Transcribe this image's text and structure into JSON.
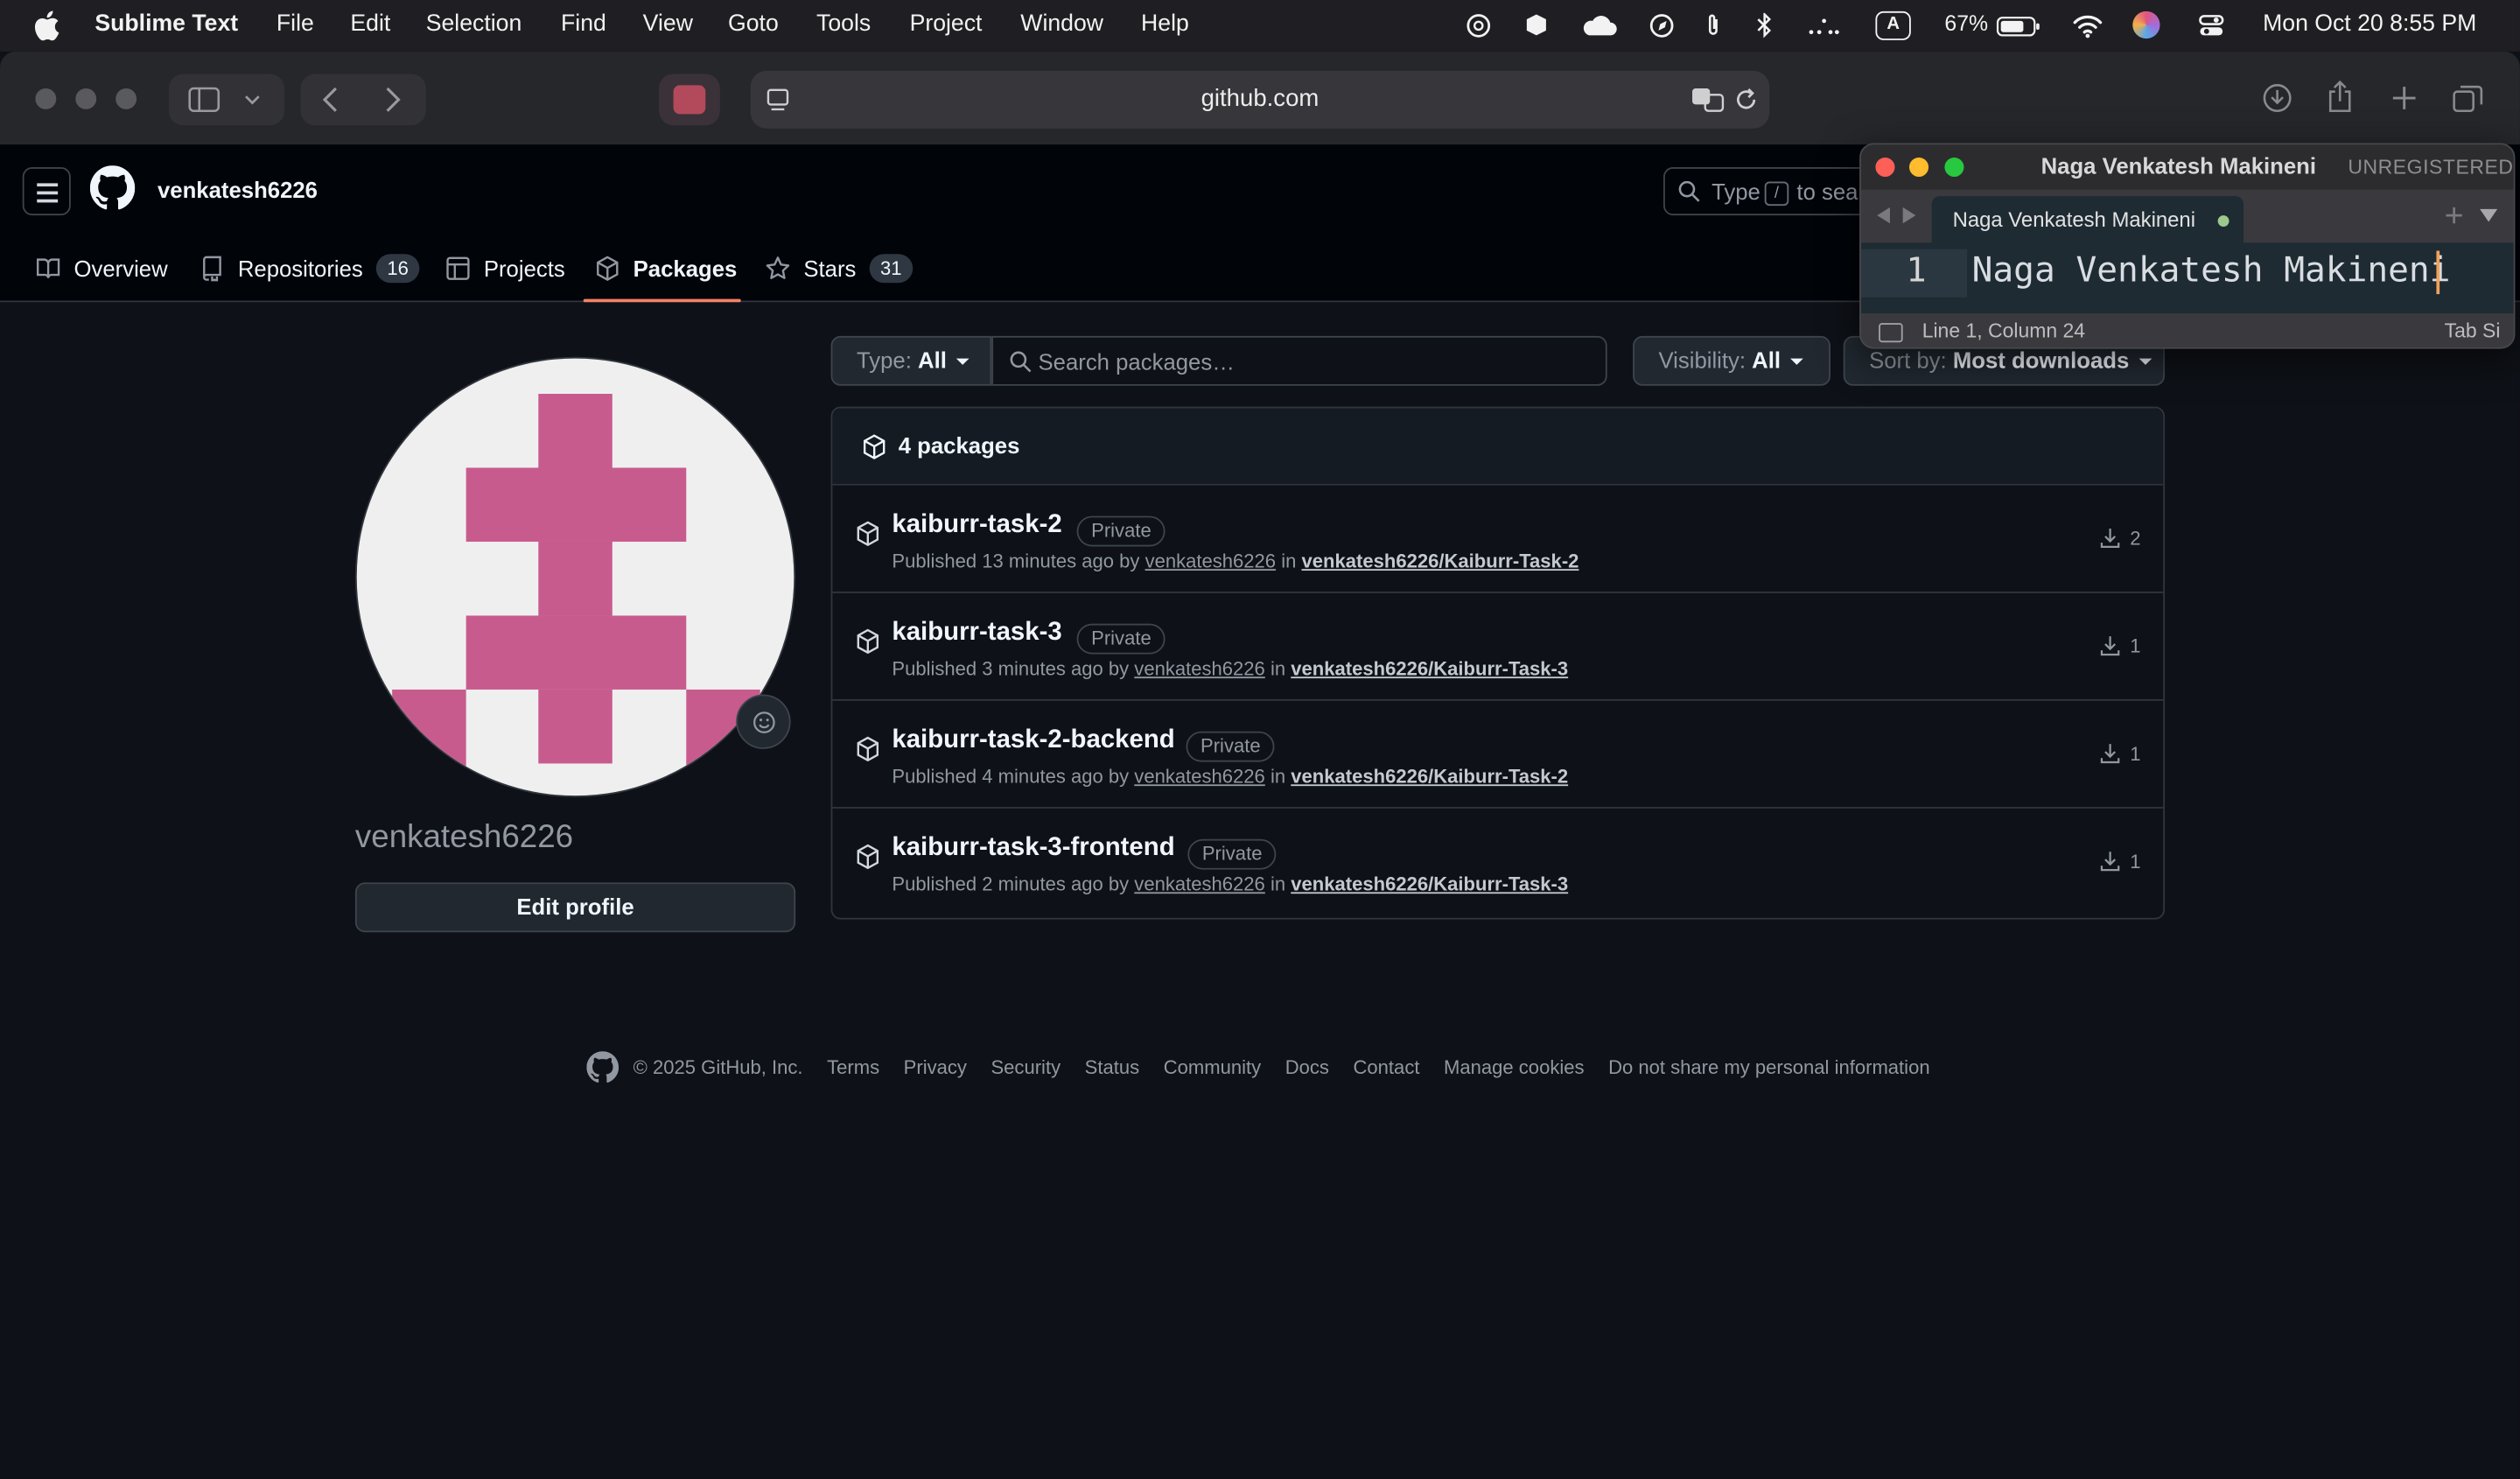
{
  "menubar": {
    "app_name": "Sublime Text",
    "menus": [
      "File",
      "Edit",
      "Selection",
      "Find",
      "View",
      "Goto",
      "Tools",
      "Project",
      "Window",
      "Help"
    ],
    "battery_percent": "67%",
    "input_source": "A",
    "clock": "Mon Oct 20  8:55 PM"
  },
  "browser": {
    "url": "github.com"
  },
  "github": {
    "username": "venkatesh6226",
    "search": {
      "text_before": "Type",
      "key": "/",
      "text_after": "to sear"
    },
    "tabs": [
      {
        "label": "Overview",
        "icon": "book-icon"
      },
      {
        "label": "Repositories",
        "icon": "repo-icon",
        "count": "16"
      },
      {
        "label": "Projects",
        "icon": "table-icon"
      },
      {
        "label": "Packages",
        "icon": "package-icon",
        "active": true
      },
      {
        "label": "Stars",
        "icon": "star-icon",
        "count": "31"
      }
    ],
    "profile": {
      "display_username": "venkatesh6226",
      "edit_profile_label": "Edit profile",
      "avatar_color": "#c85b8e"
    },
    "filters": {
      "type_label": "Type:",
      "type_value": "All",
      "search_placeholder": "Search packages…",
      "visibility_label": "Visibility:",
      "visibility_value": "All",
      "sort_label": "Sort by:",
      "sort_value": "Most downloads"
    },
    "packages_count": "4 packages",
    "packages": [
      {
        "name": "kaiburr-task-2",
        "badge": "Private",
        "published": "Published 13 minutes ago by",
        "user": "venkatesh6226",
        "in": "in",
        "repo": "venkatesh6226/Kaiburr-Task-2",
        "downloads": "2"
      },
      {
        "name": "kaiburr-task-3",
        "badge": "Private",
        "published": "Published 3 minutes ago by",
        "user": "venkatesh6226",
        "in": "in",
        "repo": "venkatesh6226/Kaiburr-Task-3",
        "downloads": "1"
      },
      {
        "name": "kaiburr-task-2-backend",
        "badge": "Private",
        "published": "Published 4 minutes ago by",
        "user": "venkatesh6226",
        "in": "in",
        "repo": "venkatesh6226/Kaiburr-Task-2",
        "downloads": "1"
      },
      {
        "name": "kaiburr-task-3-frontend",
        "badge": "Private",
        "published": "Published 2 minutes ago by",
        "user": "venkatesh6226",
        "in": "in",
        "repo": "venkatesh6226/Kaiburr-Task-3",
        "downloads": "1"
      }
    ],
    "footer": {
      "copyright": "© 2025 GitHub, Inc.",
      "links": [
        "Terms",
        "Privacy",
        "Security",
        "Status",
        "Community",
        "Docs",
        "Contact",
        "Manage cookies",
        "Do not share my personal information"
      ]
    }
  },
  "sublime": {
    "title": "Naga Venkatesh Makineni",
    "unregistered": "UNREGISTERED",
    "tab_label": "Naga Venkatesh Makineni",
    "line_number": "1",
    "code": "Naga Venkatesh Makineni",
    "status_position": "Line 1, Column 24",
    "status_tab": "Tab Si"
  },
  "colors": {
    "accent_tab_underline": "#f78166",
    "sublime_cursor": "#f0a35a",
    "modified_dot": "#9cc98e"
  }
}
